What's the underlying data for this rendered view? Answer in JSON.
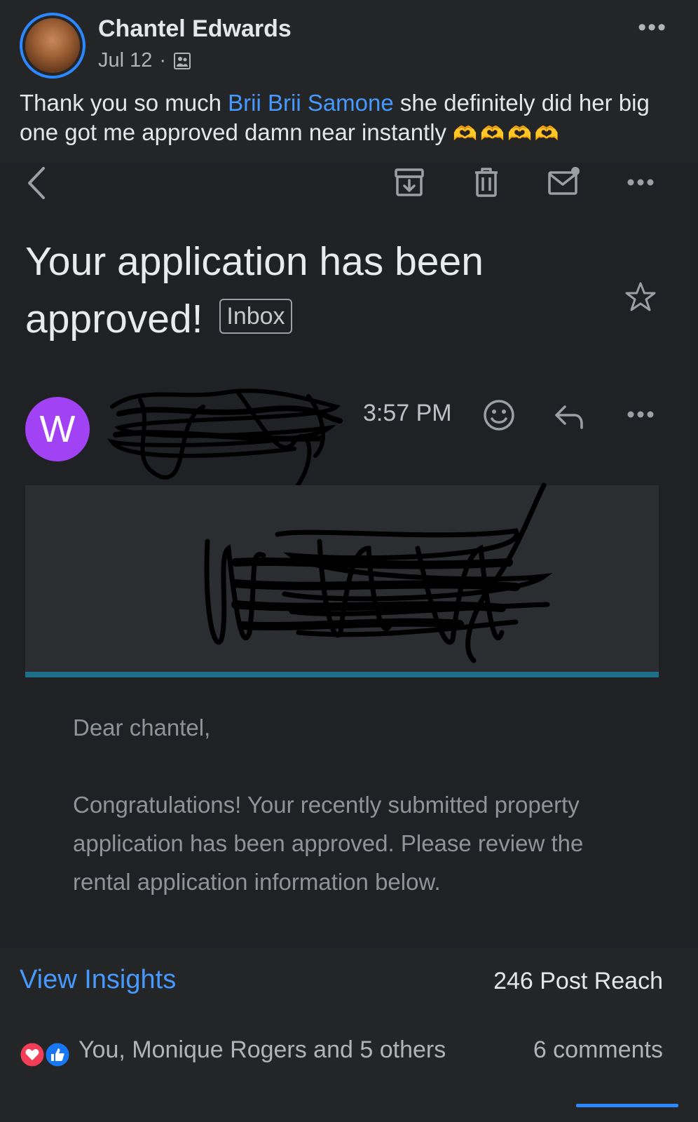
{
  "post": {
    "author": "Chantel Edwards",
    "date": "Jul 12",
    "separator": "·",
    "audience_icon": "friends-icon",
    "more_icon": "•••",
    "text_before": "Thank you so much ",
    "mention": "Brii Brii Samone",
    "text_after": " she definitely did her big one got me approved damn near instantly ",
    "emoji": "🫶🫶🫶🫶"
  },
  "gmail": {
    "toolbar": [
      "back-icon",
      "archive-icon",
      "delete-icon",
      "mark-unread-icon",
      "more-icon"
    ],
    "subject": "Your application has been approved!",
    "label_chip": "Inbox",
    "sender_initial": "W",
    "time": "3:57 PM",
    "body": {
      "greeting": "Dear chantel,",
      "paragraph": "Congratulations! Your recently submitted property application has been approved. Please review the rental application information below."
    }
  },
  "footer": {
    "view_insights": "View Insights",
    "post_reach": "246 Post Reach",
    "reactions_text": "You, Monique Rogers and 5 others",
    "comments": "6 comments"
  },
  "colors": {
    "background": "#242526",
    "gmail_background": "#202124",
    "link_blue": "#4599ff",
    "sender_avatar": "#a142f4",
    "banner_bar": "#1f6f8b"
  }
}
